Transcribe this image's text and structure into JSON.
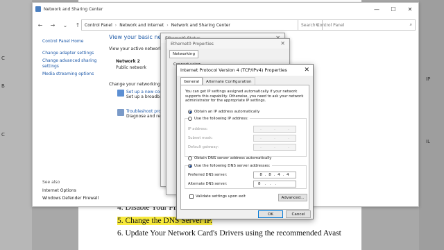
{
  "background": {
    "left_letters": [
      "C",
      "B",
      "C"
    ],
    "right_letters": [
      "IP",
      "IL"
    ],
    "doc_lines": [
      {
        "text": "4. Disable Your Fire",
        "highlight": false
      },
      {
        "text": "5. Change the DNS Server IP.",
        "highlight": true
      },
      {
        "text": "6. Update Your Network Card's Drivers using the recommended Avast",
        "highlight": false
      }
    ]
  },
  "window": {
    "title": "Network and Sharing Center",
    "controls": {
      "minimize": "—",
      "maximize": "☐",
      "close": "✕"
    }
  },
  "address": {
    "back": "←",
    "forward": "→",
    "down": "⌄",
    "up": "↑",
    "crumbs": [
      "Control Panel",
      "Network and Internet",
      "Network and Sharing Center"
    ],
    "refresh": "↻",
    "search_placeholder": "Search Control Panel"
  },
  "sidebar": {
    "items": [
      "Control Panel Home",
      "Change adapter settings",
      "Change advanced sharing settings",
      "Media streaming options"
    ],
    "see_also_label": "See also",
    "see_also": [
      "Internet Options",
      "Windows Defender Firewall"
    ]
  },
  "main": {
    "heading": "View your basic netw",
    "active_label": "View your active networks",
    "network_name": "Network 2",
    "network_type": "Public network",
    "change_label": "Change your networking set",
    "task1": "Set up a new conn",
    "task1_sub": "Set up a broadban",
    "task2": "Troubleshoot prob",
    "task2_sub": "Diagnose and rep"
  },
  "status_dialog": {
    "title": "Ethernet0 Status"
  },
  "props_dialog": {
    "title": "Ethernet0 Properties",
    "tab": "Networking",
    "line": "Connect using:"
  },
  "ipv4": {
    "title": "Internet Protocol Version 4 (TCP/IPv4) Properties",
    "tabs": [
      "General",
      "Alternate Configuration"
    ],
    "description": "You can get IP settings assigned automatically if your network supports this capability. Otherwise, you need to ask your network administrator for the appropriate IP settings.",
    "obtain_ip_auto": "Obtain an IP address automatically",
    "use_ip": "Use the following IP address:",
    "ip_address_label": "IP address:",
    "subnet_label": "Subnet mask:",
    "gateway_label": "Default gateway:",
    "obtain_dns_auto": "Obtain DNS server address automatically",
    "use_dns": "Use the following DNS server addresses:",
    "preferred_label": "Preferred DNS server:",
    "preferred_value": "8 . 8 . 4 . 4",
    "alternate_label": "Alternate DNS server:",
    "alternate_value": "8 .  .  .",
    "validate": "Validate settings upon exit",
    "advanced": "Advanced...",
    "ok": "OK",
    "cancel": "Cancel",
    "selected_ip_mode": "auto",
    "selected_dns_mode": "manual"
  }
}
